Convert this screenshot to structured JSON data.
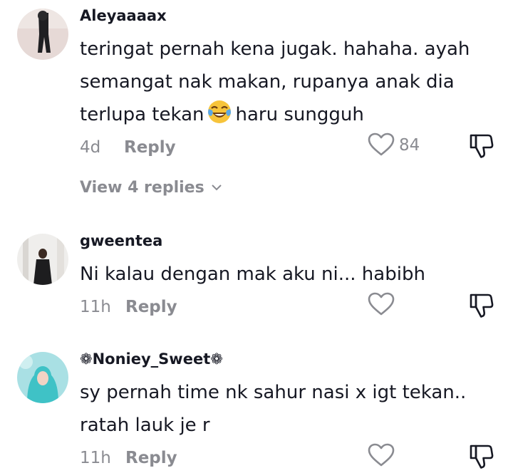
{
  "comments": [
    {
      "username": "Aleyaaaax",
      "text_before": "teringat pernah kena jugak. hahaha. ayah semangat nak makan, rupanya anak dia terlupa tekan",
      "emoji": "face-with-tears-of-joy",
      "text_after": "haru sungguh",
      "time": "4d",
      "reply_label": "Reply",
      "likes": "84",
      "view_replies": "View 4 replies"
    },
    {
      "username": "gweentea",
      "text": "Ni kalau dengan mak aku ni... habibh",
      "time": "11h",
      "reply_label": "Reply"
    },
    {
      "username": "❁Noniey_Sweet❁",
      "text": "sy pernah time nk sahur nasi x igt tekan.. ratah lauk je r",
      "time": "11h",
      "reply_label": "Reply"
    }
  ],
  "icons": {
    "like": "heart-outline-icon",
    "dislike": "thumbs-down-outline-icon",
    "expand": "chevron-down-icon"
  },
  "colors": {
    "text": "#161823",
    "muted": "#8a8b91",
    "background": "#ffffff"
  }
}
